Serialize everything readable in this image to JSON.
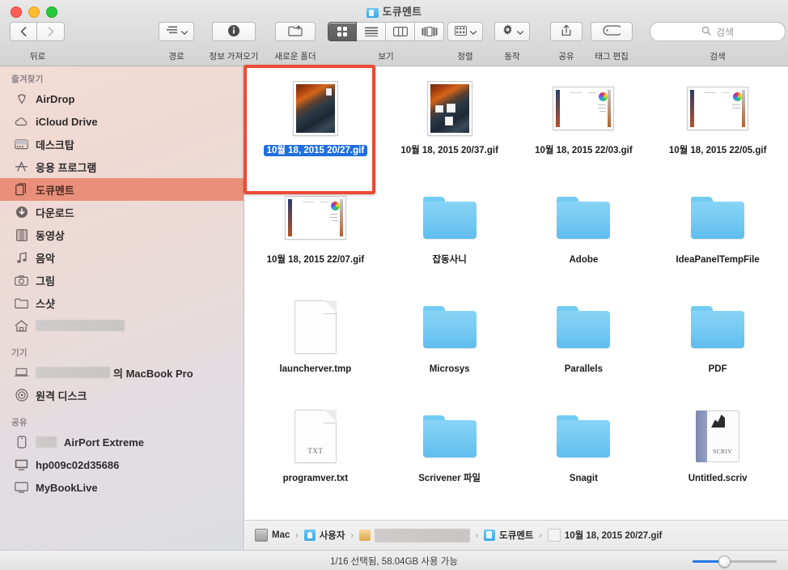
{
  "window": {
    "title": "도큐멘트",
    "title_icon": "blue-document-folder-icon"
  },
  "toolbar": {
    "back_forward": {
      "back_icon": "chevron-left-icon",
      "forward_icon": "chevron-right-icon",
      "label": "뒤로"
    },
    "arrange_path": {
      "icon": "path-list-icon",
      "label": "경로"
    },
    "get_info": {
      "icon": "info-circle-icon",
      "label": "정보 가져오기"
    },
    "new_folder": {
      "icon": "new-folder-icon",
      "label": "새로운 폴더"
    },
    "view": {
      "label": "보기",
      "options": [
        "icon-view",
        "list-view",
        "column-view",
        "coverflow-view"
      ],
      "selected": "icon-view"
    },
    "sort": {
      "icon": "sort-grid-icon",
      "label": "정렬"
    },
    "action": {
      "icon": "gear-icon",
      "label": "동작"
    },
    "share": {
      "icon": "share-up-arrow-icon",
      "label": "공유"
    },
    "edit_tags": {
      "icon": "tag-icon",
      "label": "태그 편집"
    },
    "search": {
      "icon": "search-icon",
      "placeholder": "검색",
      "value": "",
      "label": "검색"
    }
  },
  "sidebar": {
    "sections": [
      {
        "header": "즐겨찾기",
        "items": [
          {
            "label": "AirDrop",
            "icon": "airdrop-icon",
            "selected": false,
            "redacted": false
          },
          {
            "label": "iCloud Drive",
            "icon": "cloud-icon",
            "selected": false,
            "redacted": false
          },
          {
            "label": "데스크탑",
            "icon": "desktop-icon",
            "selected": false,
            "redacted": false
          },
          {
            "label": "응용 프로그램",
            "icon": "applications-icon",
            "selected": false,
            "redacted": false
          },
          {
            "label": "도큐멘트",
            "icon": "documents-icon",
            "selected": true,
            "redacted": false
          },
          {
            "label": "다운로드",
            "icon": "downloads-icon",
            "selected": false,
            "redacted": false
          },
          {
            "label": "동영상",
            "icon": "movies-icon",
            "selected": false,
            "redacted": false
          },
          {
            "label": "음악",
            "icon": "music-note-icon",
            "selected": false,
            "redacted": false
          },
          {
            "label": "그림",
            "icon": "pictures-camera-icon",
            "selected": false,
            "redacted": false
          },
          {
            "label": "스샷",
            "icon": "folder-icon",
            "selected": false,
            "redacted": false
          },
          {
            "label": "",
            "icon": "home-icon",
            "selected": false,
            "redacted": true,
            "redact_width": 110
          }
        ]
      },
      {
        "header": "기기",
        "items": [
          {
            "label": "의 MacBook Pro",
            "icon": "laptop-icon",
            "selected": false,
            "redacted": true,
            "redact_width": 92,
            "redact_before": true
          },
          {
            "label": "원격 디스크",
            "icon": "remote-disc-icon",
            "selected": false,
            "redacted": false
          }
        ]
      },
      {
        "header": "공유",
        "items": [
          {
            "label": "AirPort Extreme",
            "icon": "airport-icon",
            "selected": false,
            "redacted": true,
            "redact_width": 26,
            "redact_before": true
          },
          {
            "label": "hp009c02d35686",
            "icon": "monitor-icon",
            "selected": false,
            "redacted": false
          },
          {
            "label": "MyBookLive",
            "icon": "display-icon",
            "selected": false,
            "redacted": false
          }
        ]
      }
    ]
  },
  "files": [
    {
      "name": "10월 18, 2015 20/27.gif",
      "kind": "photo",
      "selected": true,
      "icon": "image-preview-icon"
    },
    {
      "name": "10월 18, 2015 20/37.gif",
      "kind": "photo-dots",
      "selected": false,
      "icon": "image-preview-icon"
    },
    {
      "name": "10월 18, 2015 22/03.gif",
      "kind": "shot",
      "selected": false,
      "icon": "screenshot-preview-icon"
    },
    {
      "name": "10월 18, 2015 22/05.gif",
      "kind": "shot",
      "selected": false,
      "icon": "screenshot-preview-icon"
    },
    {
      "name": "10월 18, 2015 22/07.gif",
      "kind": "shot",
      "selected": false,
      "icon": "screenshot-preview-icon"
    },
    {
      "name": "잡동사니",
      "kind": "folder",
      "selected": false,
      "icon": "folder-icon"
    },
    {
      "name": "Adobe",
      "kind": "folder",
      "selected": false,
      "icon": "folder-icon"
    },
    {
      "name": "IdeaPanelTempFile",
      "kind": "folder",
      "selected": false,
      "icon": "folder-icon"
    },
    {
      "name": "launcherver.tmp",
      "kind": "document",
      "selected": false,
      "icon": "blank-document-icon",
      "ext": ""
    },
    {
      "name": "Microsys",
      "kind": "folder",
      "selected": false,
      "icon": "folder-icon"
    },
    {
      "name": "Parallels",
      "kind": "folder",
      "selected": false,
      "icon": "folder-icon"
    },
    {
      "name": "PDF",
      "kind": "folder",
      "selected": false,
      "icon": "folder-icon"
    },
    {
      "name": "programver.txt",
      "kind": "document",
      "selected": false,
      "icon": "text-document-icon",
      "ext": "TXT"
    },
    {
      "name": "Scrivener 파일",
      "kind": "folder",
      "selected": false,
      "icon": "folder-icon"
    },
    {
      "name": "Snagit",
      "kind": "folder",
      "selected": false,
      "icon": "folder-icon"
    },
    {
      "name": "Untitled.scriv",
      "kind": "scriv",
      "selected": false,
      "icon": "scrivener-document-icon",
      "ext": "SCRIV"
    }
  ],
  "pathbar": {
    "crumbs": [
      {
        "label": "Mac",
        "icon": "hard-disk-icon",
        "redacted": false
      },
      {
        "label": "사용자",
        "icon": "users-folder-icon",
        "redacted": false
      },
      {
        "label": "",
        "icon": "home-folder-icon",
        "redacted": true,
        "redact_width": 118
      },
      {
        "label": "도큐멘트",
        "icon": "documents-folder-icon",
        "redacted": false
      },
      {
        "label": "10월 18, 2015 20/27.gif",
        "icon": "gif-file-icon",
        "redacted": false
      }
    ],
    "separator": "›"
  },
  "statusbar": {
    "text": "1/16 선택됨, 58.04GB 사용 가능",
    "zoom_slider": {
      "value_percent": 38,
      "min": 0,
      "max": 100
    }
  },
  "annotation": {
    "type": "rectangle-highlight",
    "color": "#eb4b35",
    "target": "10월 18, 2015 20/27.gif"
  },
  "colors": {
    "selection_blue": "#1f6fe0",
    "sidebar_selected": "#e8907a",
    "folder_blue": "#74c9f2",
    "annotation_red": "#eb4b35",
    "slider_blue": "#2479ea"
  }
}
